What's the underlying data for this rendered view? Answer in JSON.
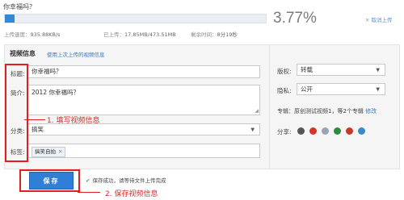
{
  "upload": {
    "file_title": "你幸福吗？",
    "progress_percent": 3.77,
    "percent_text": "3.77%",
    "cancel_label": "取消上传",
    "speed_label": "上传速度：",
    "speed_value": "935.88KB/s",
    "uploaded_label": "已上传：",
    "uploaded_value": "17.85MB/473.51MB",
    "remaining_label": "剩余时间：",
    "remaining_value": "8分19秒"
  },
  "form": {
    "section_title": "视频信息",
    "reuse_link": "使用上次上传的视频信息",
    "title_label": "标题:",
    "title_value": "你幸福吗？",
    "intro_label": "简介:",
    "intro_value": "2012 你幸福吗？",
    "category_label": "分类:",
    "category_value": "搞笑",
    "tags_label": "标签:",
    "tags": [
      "搞笑自拍"
    ],
    "annotation_1": "1. 填写视频信息"
  },
  "side": {
    "copyright_label": "版权:",
    "copyright_value": "转载",
    "privacy_label": "隐私:",
    "privacy_value": "公开",
    "album_prefix": "专辑：",
    "album_text": "原创测试视频1，等2个专辑",
    "album_edit": "修改",
    "share_label": "分享:",
    "share_icons": [
      {
        "name": "renren-icon",
        "color": "#555555"
      },
      {
        "name": "weibo-icon",
        "color": "#d8322b"
      },
      {
        "name": "qzone-icon",
        "color": "#9aa4b0"
      },
      {
        "name": "douban-icon",
        "color": "#2e8b3d"
      },
      {
        "name": "kaixin-icon",
        "color": "#c43b2a"
      },
      {
        "name": "tencent-weibo-icon",
        "color": "#3b89c9"
      }
    ]
  },
  "footer": {
    "save_label": "保存",
    "success_text": "保存成功，请等待文件上传完成",
    "annotation_2": "2. 保存视频信息"
  }
}
